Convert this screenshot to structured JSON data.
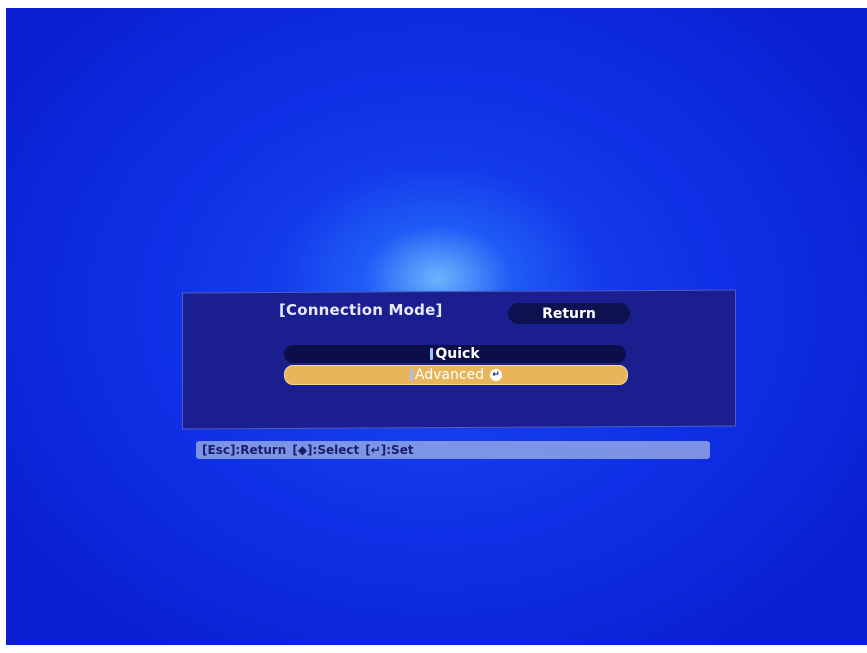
{
  "menu": {
    "title": "[Connection Mode]",
    "return_label": "Return",
    "options": [
      {
        "label": "Quick",
        "selected": false
      },
      {
        "label": "Advanced",
        "selected": true
      }
    ]
  },
  "help": {
    "esc": "[Esc]:Return",
    "select": "[◆]:Select",
    "set": "[↵]:Set"
  },
  "colors": {
    "background": "#0f30e6",
    "panel": "#1a1e8e",
    "highlight": "#e9b55b"
  },
  "icons": {
    "enter": "enter-icon",
    "arrows": "up-down-arrow-icon"
  }
}
